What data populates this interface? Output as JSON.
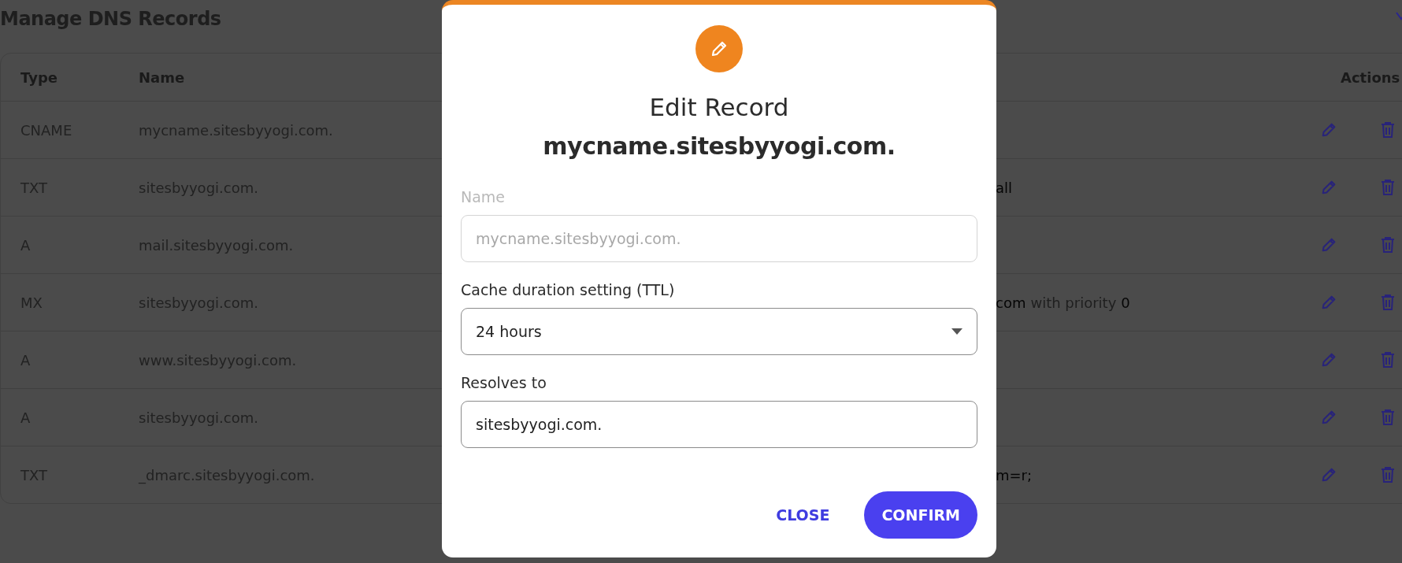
{
  "page": {
    "title": "Manage DNS Records"
  },
  "table": {
    "columns": [
      "Type",
      "Name",
      "Actions"
    ],
    "rows": [
      {
        "type": "CNAME",
        "name": "mycname.sitesbyyogi.com.",
        "value": []
      },
      {
        "type": "TXT",
        "name": "sitesbyyogi.com.",
        "value": [
          {
            "text": "all",
            "muted": false
          }
        ]
      },
      {
        "type": "A",
        "name": "mail.sitesbyyogi.com.",
        "value": []
      },
      {
        "type": "MX",
        "name": "sitesbyyogi.com.",
        "value": [
          {
            "text": "com",
            "muted": false
          },
          {
            "text": "with priority",
            "muted": true
          },
          {
            "text": "0",
            "muted": false
          }
        ]
      },
      {
        "type": "A",
        "name": "www.sitesbyyogi.com.",
        "value": []
      },
      {
        "type": "A",
        "name": "sitesbyyogi.com.",
        "value": []
      },
      {
        "type": "TXT",
        "name": "_dmarc.sitesbyyogi.com.",
        "value": [
          {
            "text": "m=r;",
            "muted": false
          }
        ]
      }
    ]
  },
  "dialog": {
    "title": "Edit Record",
    "subtitle": "mycname.sitesbyyogi.com.",
    "fields": [
      {
        "kind": "text",
        "label": "Name",
        "value": "mycname.sitesbyyogi.com.",
        "disabled": true
      },
      {
        "kind": "select",
        "label": "Cache duration setting (TTL)",
        "value": "24 hours",
        "disabled": false
      },
      {
        "kind": "text",
        "label": "Resolves to",
        "value": "sitesbyyogi.com.",
        "disabled": false
      }
    ],
    "buttons": [
      {
        "label": "CLOSE",
        "kind": "text"
      },
      {
        "label": "CONFIRM",
        "kind": "primary"
      }
    ]
  }
}
